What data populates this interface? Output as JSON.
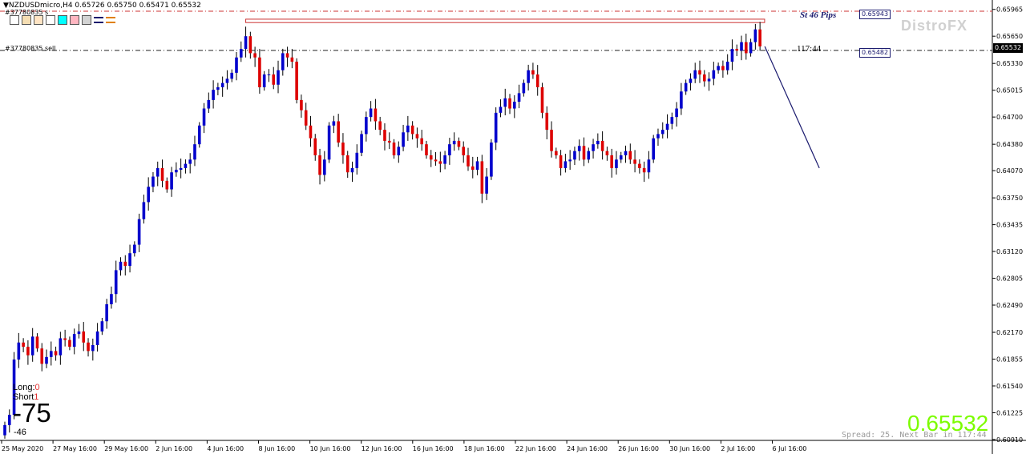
{
  "header": {
    "symbol_line": "NZDUSDmicro,H4  0.65726 0.65750 0.65471 0.65532",
    "ticket_top": "#37780835 s",
    "ticket_sell": "#37780835 sell"
  },
  "toolbar_swatches": [
    "#ffffff",
    "#f5deb3",
    "#ffe4c4",
    "#ffffff",
    "#00ffff",
    "#ffb6c1",
    "#d3d3d3"
  ],
  "toolbar_icons": [
    "blue-lines-icon",
    "orange-lines-icon"
  ],
  "watermark": "DistroFX",
  "annotation_pips": "St 46 Pips",
  "timer_label": "117:44",
  "levels": {
    "upper": "0.65943",
    "lower": "0.65482"
  },
  "current_price_tag": "0.65532",
  "stats": {
    "long_label": "Long:",
    "long_value": "0",
    "short_label": "Short",
    "short_value": "1",
    "big_number": "-75",
    "small_number": "-46"
  },
  "big_price": "0.65532",
  "spread_text": "Spread: 25. Next Bar in 117:44",
  "colors": {
    "bull": "#0000cc",
    "bear": "#dd0000",
    "level_line": "#cc3333",
    "projection": "#1a1a6e",
    "big_price": "#7cfc00"
  },
  "chart_data": {
    "type": "candlestick",
    "symbol": "NZDUSDmicro",
    "timeframe": "H4",
    "ylim": [
      0.609,
      0.66
    ],
    "y_ticks": [
      "0.65965",
      "0.65650",
      "0.65330",
      "0.65015",
      "0.64700",
      "0.64380",
      "0.64070",
      "0.63750",
      "0.63435",
      "0.63120",
      "0.62805",
      "0.62490",
      "0.62170",
      "0.61855",
      "0.61540",
      "0.61225",
      "0.60910"
    ],
    "x_ticks": [
      "25 May 2020",
      "27 May 16:00",
      "29 May 16:00",
      "2 Jun 16:00",
      "4 Jun 16:00",
      "8 Jun 16:00",
      "10 Jun 16:00",
      "12 Jun 16:00",
      "16 Jun 16:00",
      "18 Jun 16:00",
      "22 Jun 16:00",
      "24 Jun 16:00",
      "26 Jun 16:00",
      "30 Jun 16:00",
      "2 Jul 16:00",
      "6 Jul 16:00"
    ],
    "close": [
      0.6108,
      0.612,
      0.6185,
      0.6205,
      0.62,
      0.619,
      0.6212,
      0.6198,
      0.618,
      0.6188,
      0.6195,
      0.619,
      0.621,
      0.6208,
      0.62,
      0.6215,
      0.6218,
      0.6205,
      0.6195,
      0.6202,
      0.6218,
      0.623,
      0.625,
      0.6262,
      0.629,
      0.63,
      0.6295,
      0.631,
      0.632,
      0.635,
      0.637,
      0.6388,
      0.64,
      0.641,
      0.6395,
      0.6385,
      0.6405,
      0.6408,
      0.641,
      0.6415,
      0.642,
      0.6438,
      0.646,
      0.648,
      0.649,
      0.6502,
      0.6505,
      0.651,
      0.6515,
      0.6522,
      0.654,
      0.655,
      0.6565,
      0.6545,
      0.654,
      0.6505,
      0.652,
      0.652,
      0.6508,
      0.6525,
      0.6545,
      0.654,
      0.6535,
      0.649,
      0.6478,
      0.646,
      0.6445,
      0.6425,
      0.6402,
      0.642,
      0.646,
      0.6465,
      0.644,
      0.6425,
      0.6405,
      0.641,
      0.6428,
      0.645,
      0.647,
      0.648,
      0.6465,
      0.6455,
      0.6442,
      0.644,
      0.6425,
      0.6435,
      0.6452,
      0.646,
      0.645,
      0.6445,
      0.6438,
      0.6425,
      0.642,
      0.6418,
      0.6415,
      0.6425,
      0.6438,
      0.6442,
      0.6435,
      0.6425,
      0.6412,
      0.6408,
      0.6418,
      0.638,
      0.64,
      0.644,
      0.6475,
      0.6482,
      0.6492,
      0.648,
      0.6488,
      0.6498,
      0.651,
      0.6525,
      0.652,
      0.6505,
      0.6475,
      0.6455,
      0.643,
      0.6425,
      0.641,
      0.6418,
      0.642,
      0.643,
      0.6436,
      0.642,
      0.643,
      0.6438,
      0.6442,
      0.643,
      0.6425,
      0.641,
      0.642,
      0.6425,
      0.643,
      0.642,
      0.6415,
      0.641,
      0.6405,
      0.642,
      0.6445,
      0.645,
      0.6455,
      0.6462,
      0.647,
      0.648,
      0.65,
      0.651,
      0.6515,
      0.6525,
      0.652,
      0.6512,
      0.6515,
      0.6525,
      0.653,
      0.6525,
      0.6535,
      0.655,
      0.6548,
      0.6558,
      0.6545,
      0.6558,
      0.6573,
      0.6553
    ],
    "open0": 0.6096,
    "projection": {
      "from_bar": 163,
      "to_bar": 172,
      "to_price": 0.641
    },
    "levels": [
      0.65943,
      0.65482
    ],
    "resistance_box": {
      "from_bar": 52,
      "to_bar": 164,
      "top": 0.6585,
      "bottom": 0.6581
    }
  }
}
